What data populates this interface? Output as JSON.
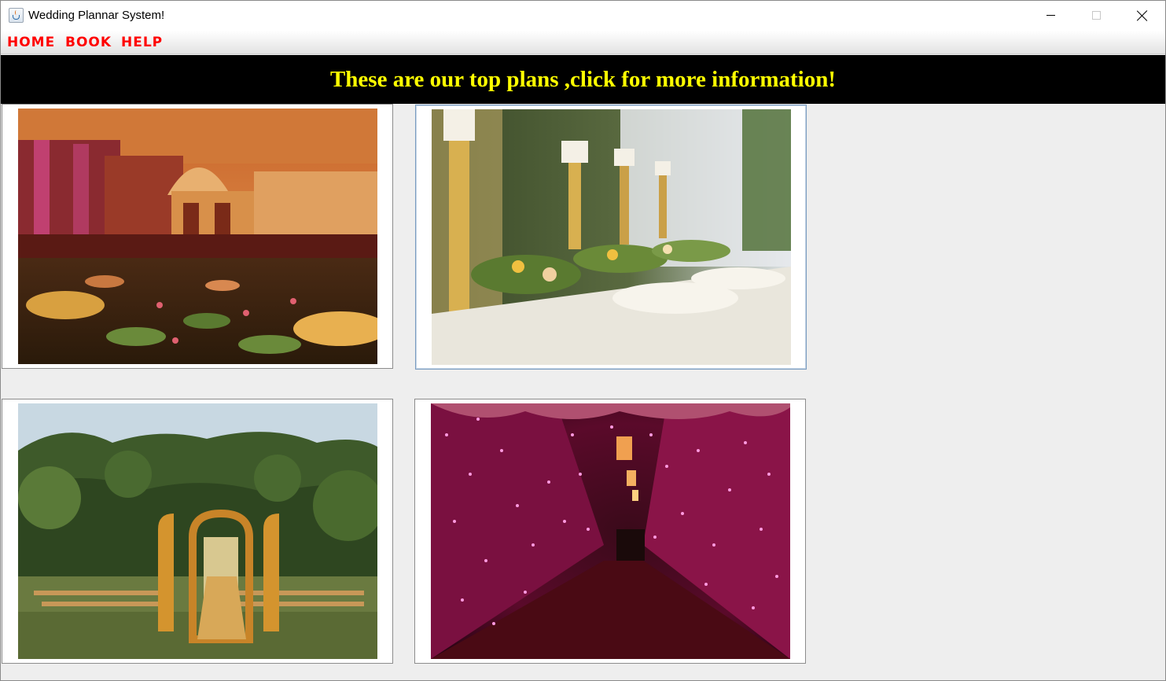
{
  "window": {
    "title": "Wedding Plannar System!"
  },
  "menu": {
    "items": [
      {
        "label": "HOME"
      },
      {
        "label": "BOOK"
      },
      {
        "label": "HELP"
      }
    ]
  },
  "banner": {
    "text": "These are our top plans ,click for more information!"
  },
  "plans": [
    {
      "image": "indoor-palace-pool-decor-photo"
    },
    {
      "image": "candle-table-setting-photo"
    },
    {
      "image": "garden-arch-ceremony-photo"
    },
    {
      "image": "fairy-light-tunnel-photo"
    }
  ],
  "colors": {
    "menu_text": "#ff0000",
    "banner_bg": "#000000",
    "banner_text": "#ffff00",
    "window_bg": "#eeeeee"
  }
}
